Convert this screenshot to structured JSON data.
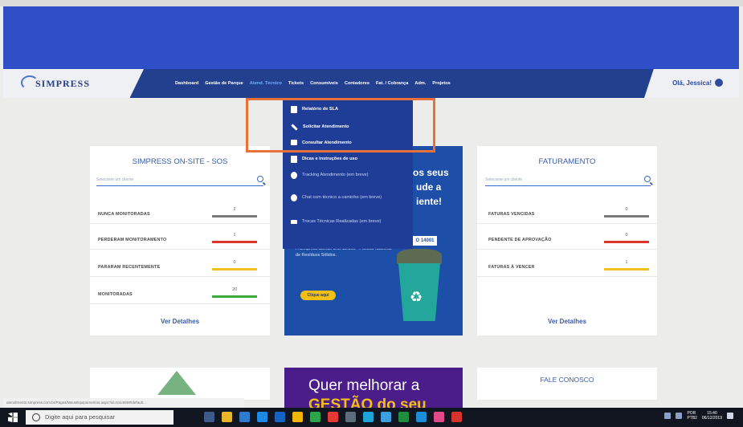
{
  "brand": {
    "logo": "SIMPRESS"
  },
  "nav": {
    "items": [
      "Dashboard",
      "Gestão de Parque",
      "Atend. Técnico",
      "Tickets",
      "Consumíveis",
      "Contadores",
      "Fat. / Cobrança",
      "Adm.",
      "Projetos"
    ],
    "active_index": 2
  },
  "greeting": "Olá, Jessica!",
  "dropdown": {
    "items": [
      "Relatório de SLA",
      "Solicitar Atendimento",
      "Consultar Atendimento",
      "Dicas e instruções de uso",
      "Tracking Atendimento (em breve)",
      "Chat com técnico a caminho (em breve)",
      "Trocas Técnicas Realizadas (em breve)"
    ]
  },
  "card_sos": {
    "title": "SIMPRESS ON-SITE - SOS",
    "search_placeholder": "Selecione um cliente",
    "rows": [
      {
        "label": "NUNCA MONITORADAS",
        "value": "2",
        "color": "#7a7a7a"
      },
      {
        "label": "PERDERAM MONITORAMENTO",
        "value": "1",
        "color": "#d9352b"
      },
      {
        "label": "PARARAM RECENTEMENTE",
        "value": "0",
        "color": "#f0c020"
      },
      {
        "label": "MONITORADAS",
        "value": "20",
        "color": "#3aa83a"
      }
    ],
    "details": "Ver Detalhes"
  },
  "card_fat": {
    "title": "FATURAMENTO",
    "search_placeholder": "Selecione um cliente",
    "rows": [
      {
        "label": "FATURAS VENCIDAS",
        "value": "0",
        "color": "#7a7a7a"
      },
      {
        "label": "PENDENTE DE APROVAÇÃO",
        "value": "0",
        "color": "#d9352b"
      },
      {
        "label": "FATURAS À VENCER",
        "value": "1",
        "color": "#f0c020"
      }
    ],
    "details": "Ver Detalhes"
  },
  "promo": {
    "line1": "os seus",
    "line2": "ude a",
    "line3": "iente!",
    "iso": "O 14001",
    "body": "A Simpress atende a lei 12.305 - Política Nacional de Resíduos Sólidos.",
    "button": "Clique aqui"
  },
  "promo2": {
    "line1": "Quer melhorar a",
    "line2": "GESTÃO do seu"
  },
  "contact": {
    "title": "FALE CONOSCO"
  },
  "status_url": "atendimento.simpress.com.br/Pages/MeusEquipamentos.aspx?id=5114838#default...",
  "taskbar": {
    "search_placeholder": "Digite aqui para pesquisar",
    "icons": [
      "task-view-icon",
      "explorer-icon",
      "store-icon",
      "edge-icon",
      "outlook-icon",
      "chrome-icon",
      "photos-icon",
      "acrobat-icon",
      "calculator-icon",
      "app-icon-1",
      "app-icon-2",
      "excel-icon",
      "skype-icon",
      "app-icon-3",
      "app-icon-4"
    ],
    "icon_colors": [
      "#3d5a8a",
      "#e7b52c",
      "#2f7ad1",
      "#1e88e5",
      "#1565c0",
      "#f4b400",
      "#2ba44a",
      "#e53935",
      "#5e6b7a",
      "#1fa3d8",
      "#3ca0e0",
      "#1e8e3e",
      "#1a8cd8",
      "#e04a8a",
      "#d8322c"
    ],
    "lang": "POR",
    "lang2": "PTB2",
    "time": "15:40",
    "date": "06/12/2019"
  }
}
